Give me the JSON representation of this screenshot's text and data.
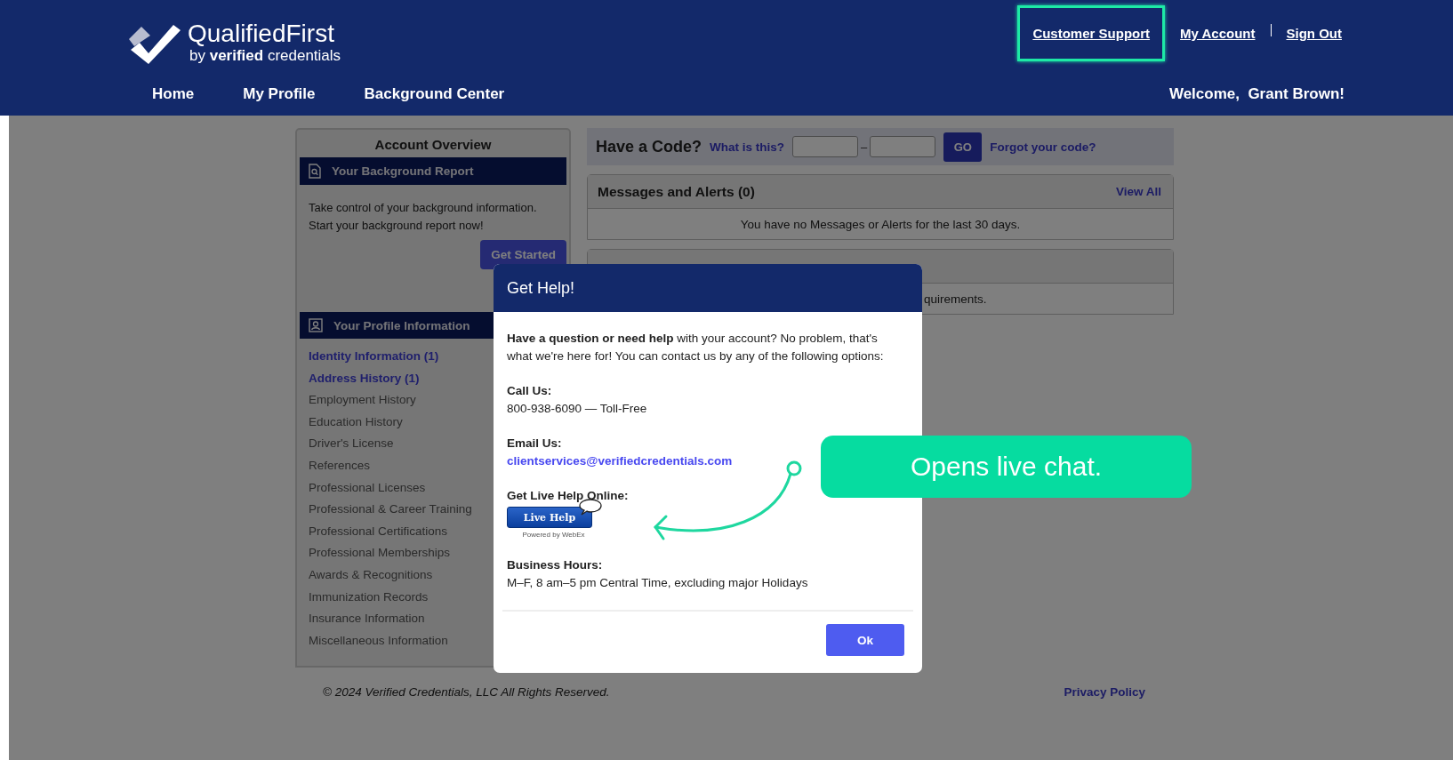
{
  "header": {
    "logo": {
      "name": "QualifiedFirst",
      "tagline": "by **verified** credentials"
    },
    "top_links": [
      {
        "label": "Customer Support",
        "highlighted": true
      },
      {
        "label": "My Account",
        "highlighted": false
      },
      {
        "label": "Sign Out",
        "highlighted": false
      }
    ],
    "nav": [
      "Home",
      "My Profile",
      "Background Center"
    ],
    "welcome": "Welcome,  Grant Brown!"
  },
  "account_overview": {
    "title": "Account Overview",
    "background_report": {
      "title": "Your Background Report",
      "text": "Take control of your background information. Start your background report now!",
      "button": "Get Started"
    },
    "profile": {
      "title": "Your Profile Information",
      "items": [
        {
          "label": "Identity Information (1)",
          "has_entries": true
        },
        {
          "label": "Address History (1)",
          "has_entries": true
        },
        {
          "label": "Employment History",
          "has_entries": false
        },
        {
          "label": "Education History",
          "has_entries": false
        },
        {
          "label": "Driver's License",
          "has_entries": false
        },
        {
          "label": "References",
          "has_entries": false
        },
        {
          "label": "Professional Licenses",
          "has_entries": false
        },
        {
          "label": "Professional & Career Training",
          "has_entries": false
        },
        {
          "label": "Professional Certifications",
          "has_entries": false
        },
        {
          "label": "Professional Memberships",
          "has_entries": false
        },
        {
          "label": "Awards & Recognitions",
          "has_entries": false
        },
        {
          "label": "Immunization Records",
          "has_entries": false
        },
        {
          "label": "Insurance Information",
          "has_entries": false
        },
        {
          "label": "Miscellaneous Information",
          "has_entries": false
        }
      ]
    }
  },
  "code_bar": {
    "title": "Have a Code?",
    "help_link": "What is this?",
    "separator": "–",
    "button": "GO",
    "forgot_link": "Forgot your code?"
  },
  "messages": {
    "title": "Messages and Alerts (0)",
    "link": "View All",
    "text": "You have no Messages or Alerts for the last 30 days."
  },
  "requirements": {
    "text": "quirements."
  },
  "footer": {
    "copyright": "© 2024 Verified Credentials, LLC All Rights Reserved.",
    "privacy": "Privacy Policy"
  },
  "modal": {
    "title": "Get Help!",
    "intro": "**Have a question or need help** with your account? No problem, that's what we're here for! You can contact us by any of the following options:",
    "sections": [
      {
        "kind": "text",
        "label": "Call Us:",
        "value": "800-938-6090 — Toll-Free"
      },
      {
        "kind": "link",
        "label": "Email Us:",
        "value": "clientservices@verifiedcredentials.com"
      },
      {
        "kind": "live_help",
        "label": "Get Live Help Online:",
        "value": "Live Help",
        "caption": "Powered by WebEx"
      },
      {
        "kind": "text",
        "label": "Business Hours:",
        "value": "M–F, 8 am–5 pm Central Time, excluding major Holidays"
      }
    ],
    "button": "Ok"
  },
  "callout": {
    "text": "Opens live chat."
  }
}
